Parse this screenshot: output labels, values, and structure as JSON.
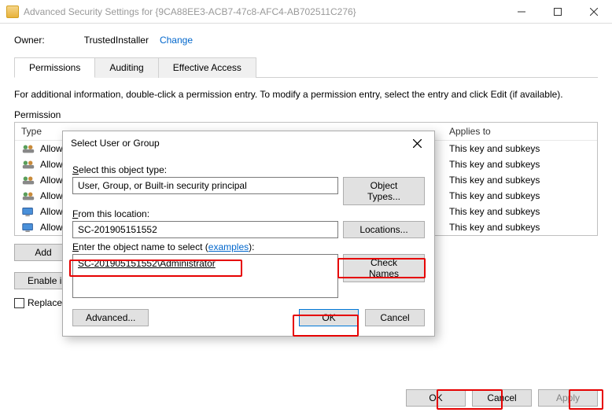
{
  "window": {
    "title": "Advanced Security Settings for {9CA88EE3-ACB7-47c8-AFC4-AB702511C276}"
  },
  "owner": {
    "label": "Owner:",
    "value": "TrustedInstaller",
    "change": "Change"
  },
  "tabs": {
    "permissions": "Permissions",
    "auditing": "Auditing",
    "effective": "Effective Access"
  },
  "info": "For additional information, double-click a permission entry. To modify a permission entry, select the entry and click Edit (if available).",
  "perm_label": "Permission",
  "columns": {
    "type": "Type",
    "applies": "Applies to"
  },
  "entries": [
    {
      "type": "Allow",
      "applies": "This key and subkeys",
      "icon": "users"
    },
    {
      "type": "Allow",
      "applies": "This key and subkeys",
      "icon": "users"
    },
    {
      "type": "Allow",
      "applies": "This key and subkeys",
      "icon": "users"
    },
    {
      "type": "Allow",
      "applies": "This key and subkeys",
      "icon": "users"
    },
    {
      "type": "Allow",
      "applies": "This key and subkeys",
      "icon": "computer"
    },
    {
      "type": "Allow",
      "applies": "This key and subkeys",
      "icon": "computer"
    }
  ],
  "buttons": {
    "add": "Add",
    "enable_inh": "Enable inheritance",
    "ok": "OK",
    "cancel": "Cancel",
    "apply": "Apply"
  },
  "replace_chk": "Replace all child object permission entries with inheritable permission entries from this object",
  "dialog": {
    "title": "Select User or Group",
    "obj_type_lbl": "Select this object type:",
    "obj_type_val": "User, Group, or Built-in security principal",
    "obj_types_btn": "Object Types...",
    "loc_lbl": "From this location:",
    "loc_val": "SC-201905151552",
    "loc_btn": "Locations...",
    "name_lbl_pre": "Enter the object name to select (",
    "name_lbl_link": "examples",
    "name_lbl_post": "):",
    "name_val": "SC-201905151552\\Administrator",
    "check_btn": "Check Names",
    "advanced": "Advanced...",
    "ok": "OK",
    "cancel": "Cancel"
  }
}
